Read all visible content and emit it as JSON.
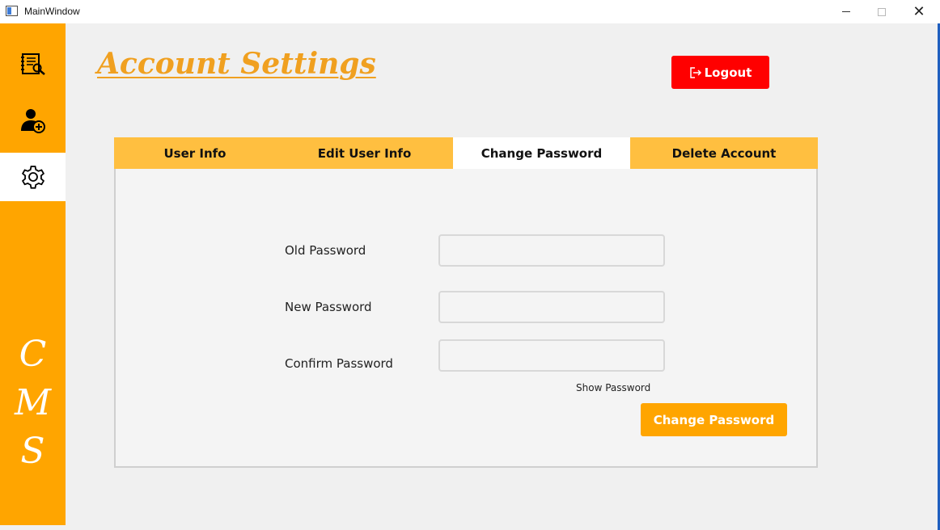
{
  "window": {
    "title": "MainWindow"
  },
  "sidebar": {
    "items": [
      {
        "icon": "notebook-icon"
      },
      {
        "icon": "add-user-icon"
      },
      {
        "icon": "gear-icon"
      }
    ],
    "brand": [
      "C",
      "M",
      "S"
    ]
  },
  "header": {
    "title": "Account Settings",
    "logout_label": "Logout"
  },
  "tabs": [
    {
      "label": "User Info"
    },
    {
      "label": "Edit User Info"
    },
    {
      "label": "Change Password"
    },
    {
      "label": "Delete Account"
    }
  ],
  "form": {
    "old_password_label": "Old Password",
    "new_password_label": "New Password",
    "confirm_password_label": "Confirm Password",
    "old_password_value": "",
    "new_password_value": "",
    "confirm_password_value": "",
    "show_password_label": "Show Password",
    "submit_label": "Change Password"
  },
  "colors": {
    "accent": "#ffa500",
    "tab_bar": "#ffbf40",
    "logout": "#ff0000",
    "title": "#f0a020"
  }
}
